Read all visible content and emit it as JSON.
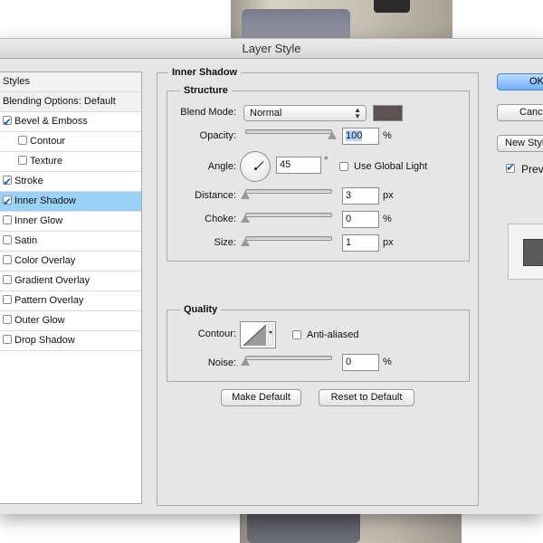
{
  "window": {
    "title": "Layer Style"
  },
  "styles_panel": {
    "header": "Styles",
    "blending": "Blending Options: Default",
    "items": [
      {
        "label": "Bevel & Emboss",
        "checked": true
      },
      {
        "label": "Contour",
        "checked": false
      },
      {
        "label": "Texture",
        "checked": false
      },
      {
        "label": "Stroke",
        "checked": true
      },
      {
        "label": "Inner Shadow",
        "checked": true
      },
      {
        "label": "Inner Glow",
        "checked": false
      },
      {
        "label": "Satin",
        "checked": false
      },
      {
        "label": "Color Overlay",
        "checked": false
      },
      {
        "label": "Gradient Overlay",
        "checked": false
      },
      {
        "label": "Pattern Overlay",
        "checked": false
      },
      {
        "label": "Outer Glow",
        "checked": false
      },
      {
        "label": "Drop Shadow",
        "checked": false
      }
    ]
  },
  "inner_shadow": {
    "title": "Inner Shadow",
    "structure": {
      "title": "Structure",
      "blend_mode_label": "Blend Mode:",
      "blend_mode_value": "Normal",
      "shadow_color": "#5a5351",
      "opacity_label": "Opacity:",
      "opacity_value": "100",
      "opacity_unit": "%",
      "opacity_level": 1.0,
      "angle_label": "Angle:",
      "angle_value": "45",
      "angle_unit": "°",
      "global_light_label": "Use Global Light",
      "global_light_checked": false,
      "distance_label": "Distance:",
      "distance_value": "3",
      "distance_unit": "px",
      "choke_label": "Choke:",
      "choke_value": "0",
      "choke_unit": "%",
      "size_label": "Size:",
      "size_value": "1",
      "size_unit": "px"
    },
    "quality": {
      "title": "Quality",
      "contour_label": "Contour:",
      "anti_aliased_label": "Anti-aliased",
      "anti_aliased_checked": false,
      "noise_label": "Noise:",
      "noise_value": "0",
      "noise_unit": "%"
    },
    "make_default_label": "Make Default",
    "reset_default_label": "Reset to Default"
  },
  "right_panel": {
    "ok_label": "OK",
    "cancel_label": "Cancel",
    "new_style_label": "New Style...",
    "preview_label": "Preview",
    "preview_checked": true
  }
}
